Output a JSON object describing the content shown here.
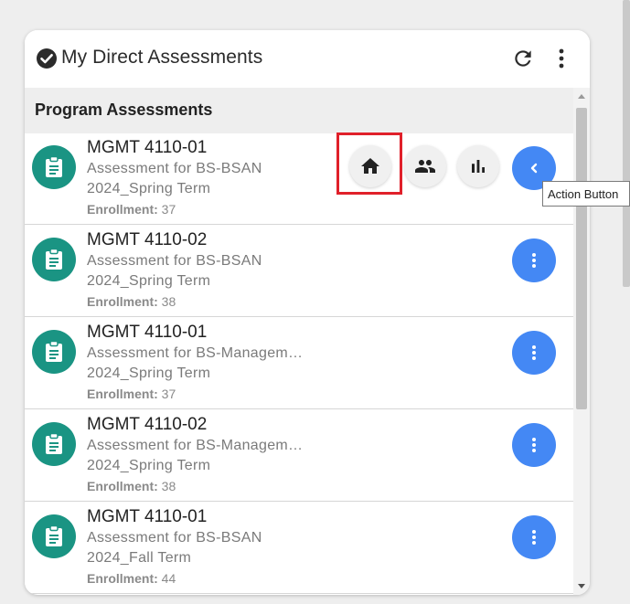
{
  "header": {
    "title": "My Direct Assessments",
    "icons": {
      "check": "check-circle-icon",
      "refresh": "refresh-icon",
      "menu": "more-vert-icon"
    }
  },
  "section": {
    "title": "Program Assessments"
  },
  "enrollment_label": "Enrollment:",
  "rows": [
    {
      "course": "MGMT 4110-01",
      "program": "Assessment for BS-BSAN",
      "term": "2024_Spring Term",
      "enrollment": "37",
      "action": "collapse",
      "expanded": true
    },
    {
      "course": "MGMT 4110-02",
      "program": "Assessment for BS-BSAN",
      "term": "2024_Spring Term",
      "enrollment": "38",
      "action": "more"
    },
    {
      "course": "MGMT 4110-01",
      "program": "Assessment for BS-Managem…",
      "term": "2024_Spring Term",
      "enrollment": "37",
      "action": "more"
    },
    {
      "course": "MGMT 4110-02",
      "program": "Assessment for BS-Managem…",
      "term": "2024_Spring Term",
      "enrollment": "38",
      "action": "more"
    },
    {
      "course": "MGMT 4110-01",
      "program": "Assessment for BS-BSAN",
      "term": "2024_Fall Term",
      "enrollment": "44",
      "action": "more"
    }
  ],
  "speed_dial": {
    "icons": [
      "home-icon",
      "people-icon",
      "bar-chart-icon"
    ]
  },
  "tooltip": {
    "text": "Action Button"
  },
  "colors": {
    "avatar": "#1a9483",
    "action": "#4488f4",
    "highlight": "#e0202a"
  }
}
